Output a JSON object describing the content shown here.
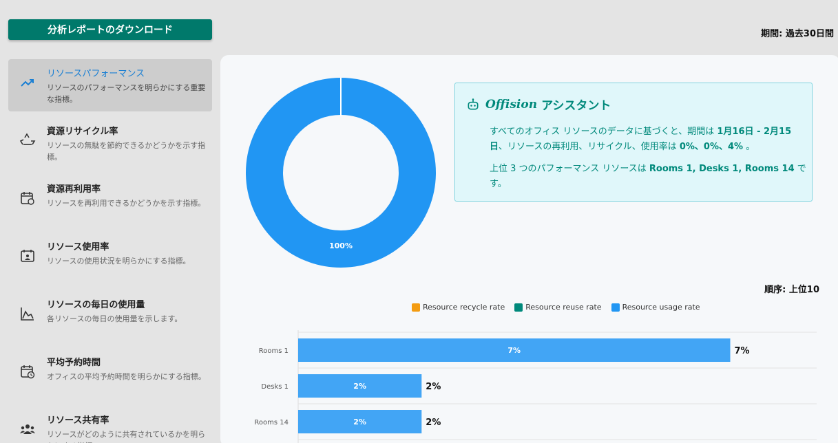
{
  "toolbar": {
    "download_label": "分析レポートのダウンロード",
    "period": "期間: 過去30日間"
  },
  "sidebar": {
    "items": [
      {
        "title": "リソースパフォーマンス",
        "desc": "リソースのパフォーマンスを明らかにする重要な指標。",
        "icon": "trend-up-icon"
      },
      {
        "title": "資源リサイクル率",
        "desc": "リソースの無駄を節約できるかどうかを示す指標。",
        "icon": "recycle-icon"
      },
      {
        "title": "資源再利用率",
        "desc": "リソースを再利用できるかどうかを示す指標。",
        "icon": "calendar-sync-icon"
      },
      {
        "title": "リソース使用率",
        "desc": "リソースの使用状況を明らかにする指標。",
        "icon": "calendar-person-icon"
      },
      {
        "title": "リソースの毎日の使用量",
        "desc": "各リソースの毎日の使用量を示します。",
        "icon": "area-chart-icon"
      },
      {
        "title": "平均予約時間",
        "desc": "オフィスの平均予約時間を明らかにする指標。",
        "icon": "calendar-clock-icon"
      },
      {
        "title": "リソース共有率",
        "desc": "リソースがどのように共有されているかを明らかにする指標。",
        "icon": "group-icon"
      }
    ]
  },
  "assistant": {
    "brand": "Offision",
    "title": "アシスタント",
    "p1_a": "すべてのオフィス リソースのデータに基づくと、期間は ",
    "p1_b": "1月16日 - 2月15日",
    "p1_c": "、リソースの再利用、リサイクル、使用率は ",
    "p1_d": "0%、0%、4%",
    "p1_e": " 。",
    "p2_a": "上位 3 つのパフォーマンス リソースは ",
    "p2_b": "Rooms 1, Desks 1, Rooms 14",
    "p2_c": " です。"
  },
  "order_label": "順序: 上位10",
  "colors": {
    "accent": "#00796b",
    "blue": "#2196f3",
    "bar": "#42a5f5",
    "orange": "#f39c12",
    "teal": "#00897b"
  },
  "chart_data": [
    {
      "type": "pie",
      "categories": [
        "Resource usage rate"
      ],
      "values": [
        100
      ],
      "labels": [
        "100%"
      ]
    },
    {
      "type": "bar",
      "orientation": "horizontal",
      "categories": [
        "Rooms 1",
        "Desks 1",
        "Rooms 14"
      ],
      "series": [
        {
          "name": "Resource recycle rate",
          "values": [
            0,
            0,
            0
          ]
        },
        {
          "name": "Resource reuse rate",
          "values": [
            0,
            0,
            0
          ]
        },
        {
          "name": "Resource usage rate",
          "values": [
            7,
            2,
            2
          ]
        }
      ],
      "labels": [
        "7%",
        "2%",
        "2%"
      ],
      "xlim": [
        0,
        8.4
      ],
      "legend": "top-center",
      "grid": true
    }
  ]
}
